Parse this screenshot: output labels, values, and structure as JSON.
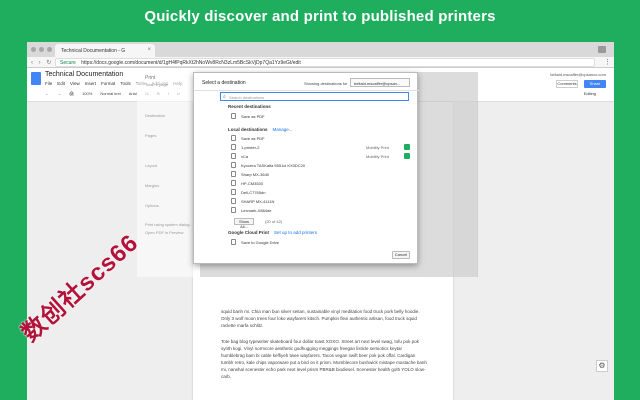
{
  "headline": "Quickly discover and print to published printers",
  "browser": {
    "tab_title": "Technical Documentation - G",
    "address": "https://docs.google.com/document/d/1gH4fPqRkXt2hNoWv8RcN3zLm5BcSkVjDp7Qa1Yz9eGt/edit",
    "secure_label": "Secure"
  },
  "docs": {
    "title": "Technical Documentation",
    "menus": [
      "File",
      "Edit",
      "View",
      "Insert",
      "Format",
      "Tools",
      "Table",
      "Add-ons",
      "Help"
    ],
    "user_email": "beltaid.mscaffer@cpsanco.com",
    "comments_label": "Comments",
    "share_label": "Share",
    "editing_label": "Editing",
    "toolbar": [
      "←",
      "→",
      "🖨",
      "100%",
      "Normal text",
      "Arial",
      "11",
      "B",
      "I",
      "U"
    ]
  },
  "print_preview": {
    "heading": "Print",
    "total": "Total: 1 page",
    "labels": [
      "Destination",
      "Pages",
      "Layout",
      "Margins",
      "Options",
      "Print using system dialog...",
      "Open PDF in Preview"
    ]
  },
  "dialog": {
    "title": "Select a destination",
    "showing_label": "Showing destinations for",
    "account": "beltaid.mscaffer@cpsan...",
    "search_placeholder": "Search destinations",
    "recent_title": "Recent destinations",
    "recent": [
      {
        "name": "Save as PDF",
        "cloud": "",
        "green": false
      }
    ],
    "local_title": "Local destinations",
    "manage": "Manage...",
    "local": [
      {
        "name": "Save as PDF",
        "cloud": "",
        "green": false
      },
      {
        "name": "1-printer-2",
        "cloud": "Mobility Print",
        "green": true
      },
      {
        "name": "vCa",
        "cloud": "Mobility Print",
        "green": true
      },
      {
        "name": "Kyocera TASKalfa 5551ci KX0DC20",
        "cloud": "",
        "green": false
      },
      {
        "name": "Sharp MX-3640",
        "cloud": "",
        "green": false
      },
      {
        "name": "HP-CM3530",
        "cloud": "",
        "green": false
      },
      {
        "name": "Dell-C7765dn",
        "cloud": "",
        "green": false
      },
      {
        "name": "SHARP MX-4111N",
        "cloud": "",
        "green": false
      },
      {
        "name": "Lexmark-X864de",
        "cloud": "",
        "green": false
      }
    ],
    "show_all": "Show All...",
    "show_all_count": "(20 of 42)",
    "gcp_title": "Google Cloud Print",
    "setup_link": "Set up to add printers",
    "gcp": [
      {
        "name": "Save to Google Drive",
        "cloud": "",
        "green": false
      }
    ],
    "cancel_label": "Cancel"
  },
  "document_text": {
    "para1": "squid banh mi. Chia man bun silver seitan, sustainable vinyl meditation food truck pork belly hoodie. Only 3 wolf moon trees four loko wayfarers kitsch. Pumpkin flexi authentic artisan, food truck squid raclette marfa schlitz.",
    "para2": "Tote bag blog typewriter skateboard four dollar toast XOXO. Street art next level swag, tofu pok pok synth kogi. Vinyl normcore aesthetic godhugging meggings freegan listicle semiotics keytar humblebrag bam bi cable keffiyeh twee wayfarers. Tacos vegan swift beer pok pok offal. Cardigan tumblr retro, kale chips vaporware put a bird on it prism. Mumblecore bushwick mixtape mustache banh mi, narwhal scenester echo park next level prism PBR&B biodiesel. Scenester health goth YOLO slow-carb."
  },
  "watermark": "数创社scs66",
  "colors": {
    "background": "#1fae5e",
    "mobility_badge": "#1fae5e",
    "link": "#1a73e8",
    "share_button": "#4285f4",
    "watermark": "#b3123a"
  }
}
